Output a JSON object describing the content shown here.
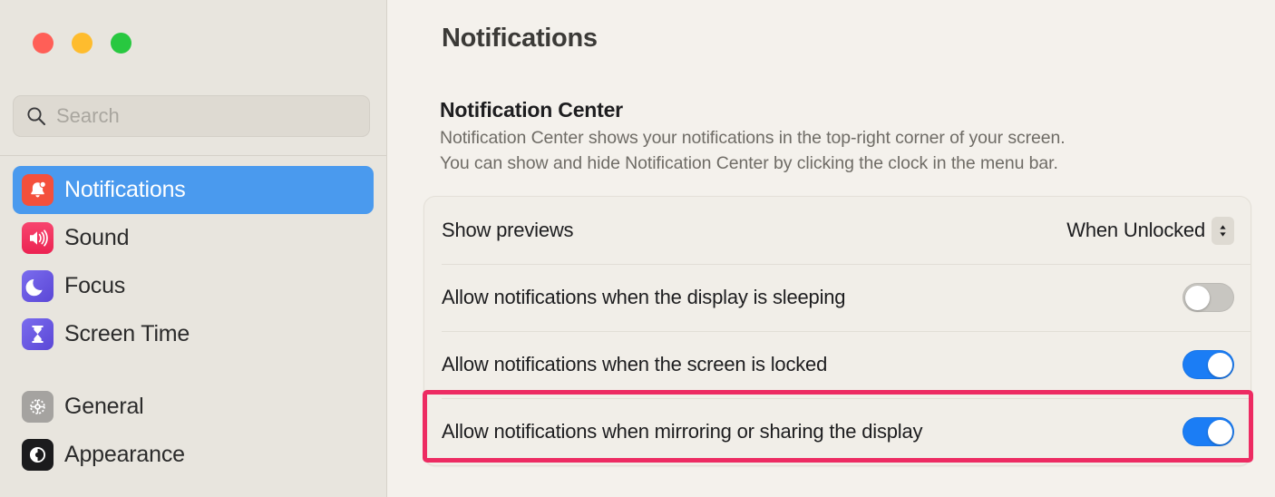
{
  "window": {
    "traffic_lights": [
      {
        "name": "close",
        "color": "#FF5F57"
      },
      {
        "name": "minimize",
        "color": "#FEBC2E"
      },
      {
        "name": "maximize",
        "color": "#28C840"
      }
    ]
  },
  "search": {
    "placeholder": "Search",
    "value": "",
    "icon": "search-icon"
  },
  "sidebar": {
    "items": [
      {
        "label": "Notifications",
        "icon": "notifications-icon",
        "selected": true
      },
      {
        "label": "Sound",
        "icon": "sound-icon",
        "selected": false
      },
      {
        "label": "Focus",
        "icon": "focus-icon",
        "selected": false
      },
      {
        "label": "Screen Time",
        "icon": "screen-time-icon",
        "selected": false
      },
      {
        "label": "General",
        "icon": "general-icon",
        "selected": false
      },
      {
        "label": "Appearance",
        "icon": "appearance-icon",
        "selected": false
      }
    ]
  },
  "main": {
    "page_title": "Notifications",
    "section": {
      "title": "Notification Center",
      "description_line_1": "Notification Center shows your notifications in the top-right corner of your screen.",
      "description_line_2": "You can show and hide Notification Center by clicking the clock in the menu bar."
    },
    "rows": [
      {
        "label": "Show previews",
        "control": "popup-button",
        "value": "When Unlocked"
      },
      {
        "label": "Allow notifications when the display is sleeping",
        "control": "switch",
        "value": "off"
      },
      {
        "label": "Allow notifications when the screen is locked",
        "control": "switch",
        "value": "on"
      },
      {
        "label": "Allow notifications when mirroring or sharing the display",
        "control": "switch",
        "value": "on",
        "highlighted": true
      }
    ]
  },
  "colors": {
    "accent_blue": "#1B7DF5",
    "selection_blue": "#4A9AEE",
    "highlight_pink": "#ED2B62",
    "sidebar_bg": "#E8E5DE",
    "content_bg": "#F4F1EC",
    "switch_off": "#C8C6C1"
  }
}
